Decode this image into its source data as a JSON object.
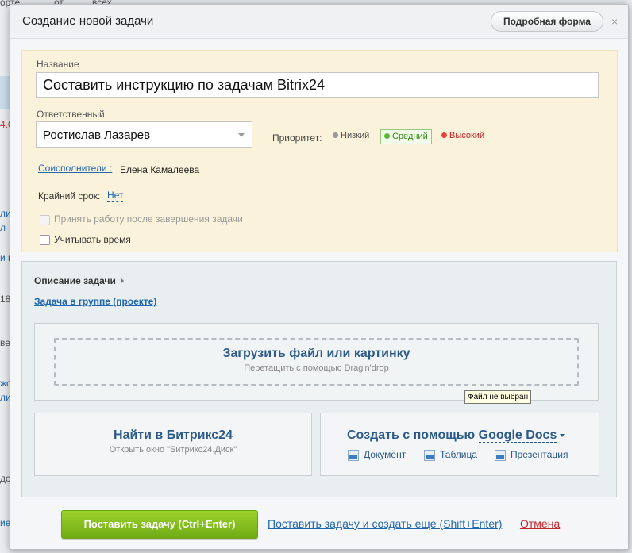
{
  "background": {
    "fragments": [
      "орте",
      "от",
      "всех",
      "4.0",
      "ли",
      "л",
      "и н",
      "18",
      "ве",
      "жо",
      "ли",
      "до",
      "ие"
    ]
  },
  "dialog": {
    "title": "Создание новой задачи",
    "full_form_button": "Подробная форма",
    "close_glyph": "×"
  },
  "form": {
    "title_label": "Название",
    "title_value": "Составить инструкцию по задачам Bitrix24",
    "responsible_label": "Ответственный",
    "responsible_value": "Ростислав Лазарев",
    "priority": {
      "label": "Приоритет:",
      "options": [
        {
          "label": "Низкий",
          "color": "#9a9a9a"
        },
        {
          "label": "Средний",
          "color": "#5cb830",
          "selected": true
        },
        {
          "label": "Высокий",
          "color": "#e5433d"
        }
      ]
    },
    "coexecutors_label": "Соисполнители :",
    "coexecutors_value": "Елена Камалеева",
    "deadline_label": "Крайний срок:",
    "deadline_value": "Нет",
    "accept_work_label": "Принять работу после завершения задачи",
    "track_time_label": "Учитывать время"
  },
  "lower": {
    "description_toggle": "Описание задачи",
    "group_link": "Задача в группе (проекте)",
    "upload": {
      "title": "Загрузить файл или картинку",
      "subtitle": "Перетащить с помощью Drag'n'drop",
      "tooltip": "Файл не выбран"
    },
    "bitrix_disk": {
      "title": "Найти в Битрикс24",
      "subtitle": "Открыть окно \"Битрикс24.Диск\""
    },
    "gdocs": {
      "title_prefix": "Создать с помощью",
      "title_brand": "Google Docs",
      "items": [
        "Документ",
        "Таблица",
        "Презентация"
      ]
    }
  },
  "footer": {
    "submit": "Поставить задачу (Ctrl+Enter)",
    "submit_and_new": "Поставить задачу и создать еще (Shift+Enter)",
    "cancel": "Отмена"
  },
  "colors": {
    "link": "#2067b0",
    "accent_green": "#6fab16",
    "panel_yellow": "#faf2da",
    "cancel_red": "#c0282d"
  }
}
